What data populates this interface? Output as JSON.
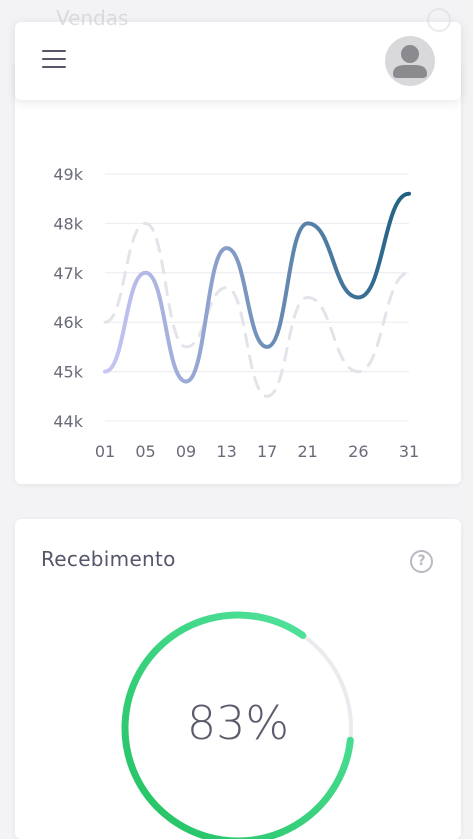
{
  "background_card": {
    "title": "Vendas"
  },
  "header": {
    "menu_icon": "hamburger-menu-icon",
    "avatar_icon": "user-avatar-icon"
  },
  "chart_data": {
    "type": "line",
    "x_ticks": [
      "01",
      "05",
      "09",
      "13",
      "17",
      "21",
      "26",
      "31"
    ],
    "y_ticks": [
      "44k",
      "45k",
      "46k",
      "47k",
      "48k",
      "49k"
    ],
    "ylim": [
      44000,
      49000
    ],
    "grid": true,
    "series": [
      {
        "style": "solid-gradient",
        "colors": [
          "#c9c6f5",
          "#1f5f82"
        ],
        "x": [
          1,
          5,
          9,
          13,
          17,
          21,
          26,
          31
        ],
        "values": [
          45000,
          47000,
          44800,
          47500,
          45500,
          48000,
          46500,
          48600
        ]
      },
      {
        "style": "dashed",
        "colors": [
          "#e3e3ea"
        ],
        "x": [
          1,
          5,
          9,
          13,
          17,
          21,
          26,
          31
        ],
        "values": [
          46000,
          48000,
          45500,
          46700,
          44500,
          46500,
          45000,
          47000
        ]
      }
    ]
  },
  "receipt": {
    "title": "Recebimento",
    "help_icon": "question-circle-icon",
    "percent": 83,
    "percent_label": "83%",
    "colors": {
      "start": "#21c060",
      "end": "#56e6a2",
      "track": "#ebebef"
    }
  }
}
